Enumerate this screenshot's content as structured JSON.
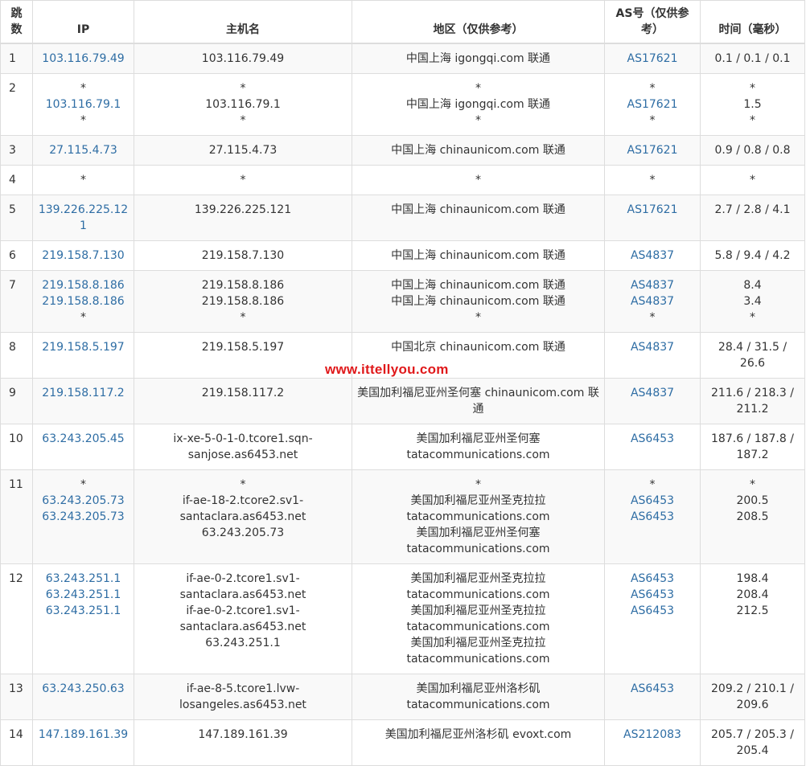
{
  "headers": {
    "hop": "跳数",
    "ip": "IP",
    "host": "主机名",
    "region": "地区（仅供参考）",
    "as": "AS号（仅供参考）",
    "time": "时间（毫秒）"
  },
  "rows": [
    {
      "hop": "1",
      "ip": [
        "103.116.79.49"
      ],
      "host": [
        "103.116.79.49"
      ],
      "region": [
        "中国上海 igongqi.com 联通"
      ],
      "as": [
        "AS17621"
      ],
      "time": [
        "0.1 / 0.1 / 0.1"
      ]
    },
    {
      "hop": "2",
      "ip": [
        "*",
        "103.116.79.1",
        "*"
      ],
      "host": [
        "*",
        "103.116.79.1",
        "*"
      ],
      "region": [
        "*",
        "中国上海 igongqi.com 联通",
        "*"
      ],
      "as": [
        "*",
        "AS17621",
        "*"
      ],
      "time": [
        "*",
        "1.5",
        "*"
      ]
    },
    {
      "hop": "3",
      "ip": [
        "27.115.4.73"
      ],
      "host": [
        "27.115.4.73"
      ],
      "region": [
        "中国上海 chinaunicom.com 联通"
      ],
      "as": [
        "AS17621"
      ],
      "time": [
        "0.9 / 0.8 / 0.8"
      ]
    },
    {
      "hop": "4",
      "ip": [
        "*"
      ],
      "host": [
        "*"
      ],
      "region": [
        "*"
      ],
      "as": [
        "*"
      ],
      "time": [
        "*"
      ]
    },
    {
      "hop": "5",
      "ip": [
        "139.226.225.121"
      ],
      "host": [
        "139.226.225.121"
      ],
      "region": [
        "中国上海 chinaunicom.com 联通"
      ],
      "as": [
        "AS17621"
      ],
      "time": [
        "2.7 / 2.8 / 4.1"
      ]
    },
    {
      "hop": "6",
      "ip": [
        "219.158.7.130"
      ],
      "host": [
        "219.158.7.130"
      ],
      "region": [
        "中国上海 chinaunicom.com 联通"
      ],
      "as": [
        "AS4837"
      ],
      "time": [
        "5.8 / 9.4 / 4.2"
      ]
    },
    {
      "hop": "7",
      "ip": [
        "219.158.8.186",
        "219.158.8.186",
        "*"
      ],
      "host": [
        "219.158.8.186",
        "219.158.8.186",
        "*"
      ],
      "region": [
        "中国上海 chinaunicom.com 联通",
        "中国上海 chinaunicom.com 联通",
        "*"
      ],
      "as": [
        "AS4837",
        "AS4837",
        "*"
      ],
      "time": [
        "8.4",
        "3.4",
        "*"
      ]
    },
    {
      "hop": "8",
      "ip": [
        "219.158.5.197"
      ],
      "host": [
        "219.158.5.197"
      ],
      "region": [
        "中国北京 chinaunicom.com 联通"
      ],
      "as": [
        "AS4837"
      ],
      "time": [
        "28.4 / 31.5 /",
        "26.6"
      ]
    },
    {
      "hop": "9",
      "ip": [
        "219.158.117.2"
      ],
      "host": [
        "219.158.117.2"
      ],
      "region": [
        "美国加利福尼亚州圣何塞 chinaunicom.com 联",
        "通"
      ],
      "as": [
        "AS4837"
      ],
      "time": [
        "211.6 / 218.3 /",
        "211.2"
      ]
    },
    {
      "hop": "10",
      "ip": [
        "63.243.205.45"
      ],
      "host": [
        "ix-xe-5-0-1-0.tcore1.sqn-",
        "sanjose.as6453.net"
      ],
      "region": [
        "美国加利福尼亚州圣何塞",
        "tatacommunications.com"
      ],
      "as": [
        "AS6453"
      ],
      "time": [
        "187.6 / 187.8 /",
        "187.2"
      ]
    },
    {
      "hop": "11",
      "ip": [
        "*",
        "63.243.205.73",
        "63.243.205.73"
      ],
      "host": [
        "*",
        "if-ae-18-2.tcore2.sv1-",
        "santaclara.as6453.net",
        "63.243.205.73"
      ],
      "region": [
        "*",
        "美国加利福尼亚州圣克拉拉",
        "tatacommunications.com",
        "美国加利福尼亚州圣何塞",
        "tatacommunications.com"
      ],
      "as": [
        "*",
        "AS6453",
        "AS6453"
      ],
      "time": [
        "*",
        "200.5",
        "208.5"
      ]
    },
    {
      "hop": "12",
      "ip": [
        "63.243.251.1",
        "63.243.251.1",
        "63.243.251.1"
      ],
      "host": [
        "if-ae-0-2.tcore1.sv1-",
        "santaclara.as6453.net",
        "if-ae-0-2.tcore1.sv1-",
        "santaclara.as6453.net",
        "63.243.251.1"
      ],
      "region": [
        "美国加利福尼亚州圣克拉拉",
        "tatacommunications.com",
        "美国加利福尼亚州圣克拉拉",
        "tatacommunications.com",
        "美国加利福尼亚州圣克拉拉",
        "tatacommunications.com"
      ],
      "as": [
        "AS6453",
        "AS6453",
        "AS6453"
      ],
      "time": [
        "198.4",
        "208.4",
        "212.5"
      ]
    },
    {
      "hop": "13",
      "ip": [
        "63.243.250.63"
      ],
      "host": [
        "if-ae-8-5.tcore1.lvw-",
        "losangeles.as6453.net"
      ],
      "region": [
        "美国加利福尼亚州洛杉矶",
        "tatacommunications.com"
      ],
      "as": [
        "AS6453"
      ],
      "time": [
        "209.2 / 210.1 /",
        "209.6"
      ]
    },
    {
      "hop": "14",
      "ip": [
        "147.189.161.39"
      ],
      "host": [
        "147.189.161.39"
      ],
      "region": [
        "美国加利福尼亚州洛杉矶 evoxt.com"
      ],
      "as": [
        "AS212083"
      ],
      "time": [
        "205.7 / 205.3 /",
        "205.4"
      ]
    }
  ],
  "watermark": "www.ittellyou.com",
  "colors": {
    "link": "#2e6da4",
    "border": "#dddddd",
    "stripe": "#f9f9f9",
    "watermark": "#e0191b"
  }
}
